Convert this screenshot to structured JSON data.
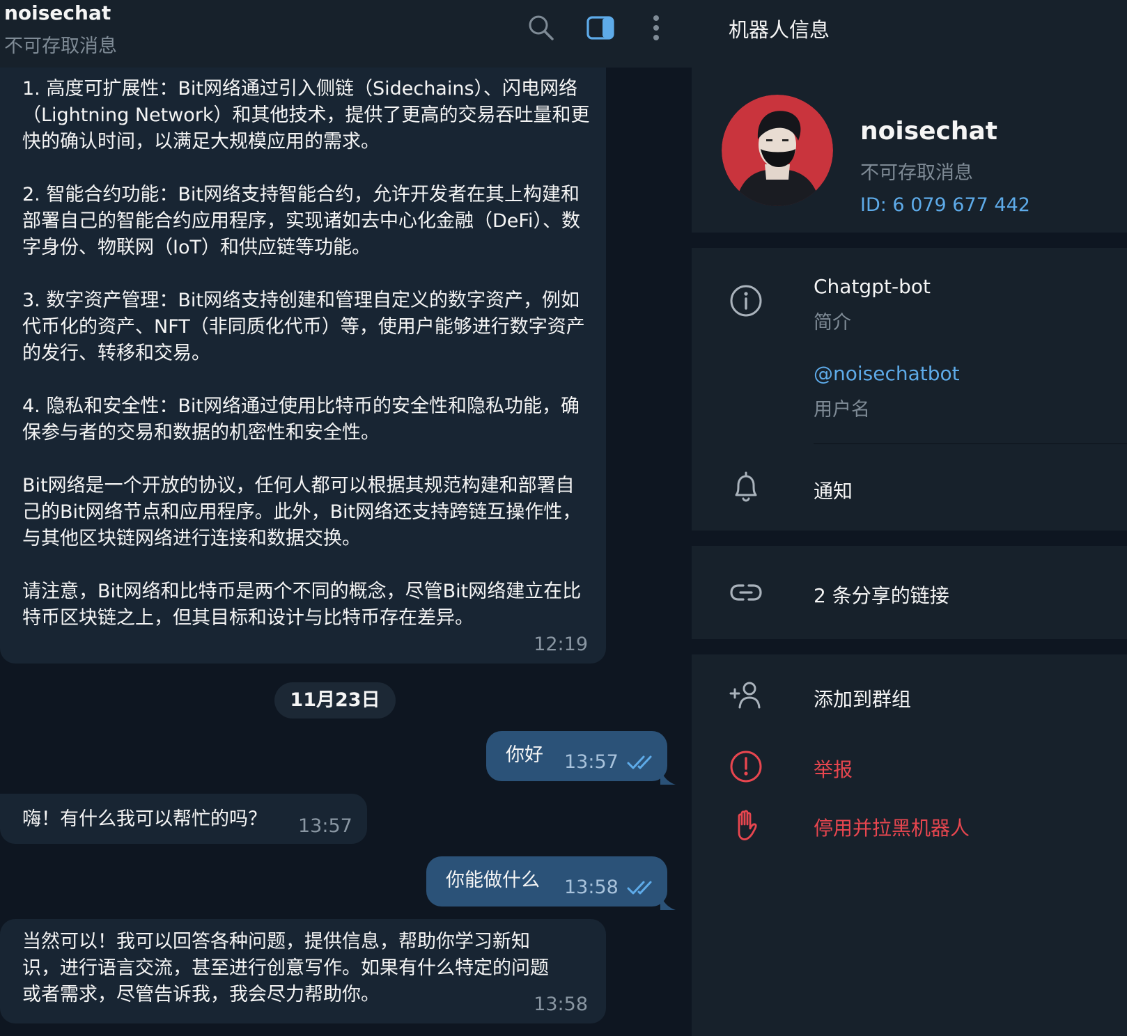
{
  "chat": {
    "title": "noisechat",
    "status": "不可存取消息",
    "header_icons": [
      "search-icon",
      "side-panel-icon",
      "more-vertical-icon"
    ]
  },
  "messages": {
    "bot_long": {
      "paragraphs": [
        "1. 高度可扩展性：Bit网络通过引入侧链（Sidechains）、闪电网络（Lightning Network）和其他技术，提供了更高的交易吞吐量和更快的确认时间，以满足大规模应用的需求。",
        "2. 智能合约功能：Bit网络支持智能合约，允许开发者在其上构建和部署自己的智能合约应用程序，实现诸如去中心化金融（DeFi）、数字身份、物联网（IoT）和供应链等功能。",
        "3. 数字资产管理：Bit网络支持创建和管理自定义的数字资产，例如代币化的资产、NFT（非同质化代币）等，使用户能够进行数字资产的发行、转移和交易。",
        "4. 隐私和安全性：Bit网络通过使用比特币的安全性和隐私功能，确保参与者的交易和数据的机密性和安全性。",
        "Bit网络是一个开放的协议，任何人都可以根据其规范构建和部署自己的Bit网络节点和应用程序。此外，Bit网络还支持跨链互操作性，与其他区块链网络进行连接和数据交换。",
        "请注意，Bit网络和比特币是两个不同的概念，尽管Bit网络建立在比特币区块链之上，但其目标和设计与比特币存在差异。"
      ],
      "time": "12:19"
    },
    "date_separator": "11月23日",
    "out_1": {
      "text": "你好",
      "time": "13:57"
    },
    "bot_2": {
      "text": "嗨！有什么我可以帮忙的吗？",
      "time": "13:57"
    },
    "out_2": {
      "text": "你能做什么",
      "time": "13:58"
    },
    "bot_3": {
      "text": "当然可以！我可以回答各种问题，提供信息，帮助你学习新知识，进行语言交流，甚至进行创意写作。如果有什么特定的问题或者需求，尽管告诉我，我会尽力帮助你。",
      "time": "13:58"
    }
  },
  "info": {
    "title": "机器人信息",
    "name": "noisechat",
    "status": "不可存取消息",
    "id": "ID: 6 079 677 442",
    "bio": "Chatgpt-bot",
    "bio_label": "简介",
    "username": "@noisechatbot",
    "username_label": "用户名",
    "notifications": "通知",
    "shared_links": "2 条分享的链接",
    "add_to_group": "添加到群组",
    "report": "举报",
    "block": "停用并拉黑机器人"
  },
  "colors": {
    "background": "#0e1621",
    "panel": "#17212b",
    "bubble_in": "#182533",
    "bubble_out": "#2b5278",
    "link": "#5eabe9",
    "danger": "#e8464f",
    "avatar_bg": "#c9343d"
  }
}
